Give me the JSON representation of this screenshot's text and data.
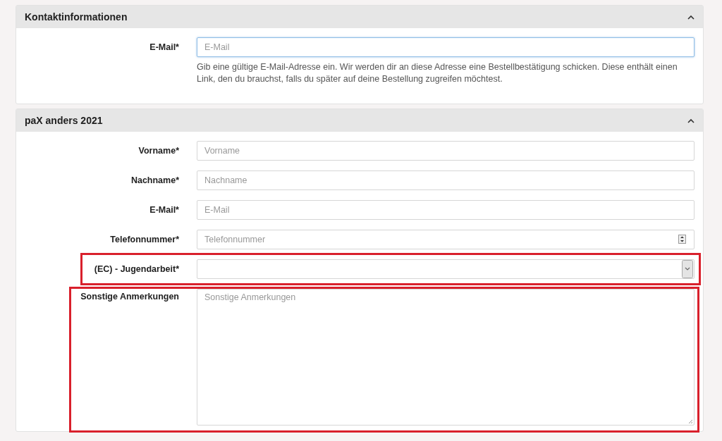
{
  "panels": [
    {
      "title": "Kontaktinformationen",
      "expanded": true,
      "fields": [
        {
          "kind": "email",
          "label": "E-Mail*",
          "placeholder": "E-Mail",
          "focused": true,
          "highlighted": false,
          "help": "Gib eine gültige E-Mail-Adresse ein. Wir werden dir an diese Adresse eine Bestellbestätigung schicken. Diese enthält einen Link, den du brauchst, falls du später auf deine Bestellung zugreifen möchtest."
        }
      ]
    },
    {
      "title": "paX anders 2021",
      "expanded": true,
      "fields": [
        {
          "kind": "text",
          "label": "Vorname*",
          "placeholder": "Vorname",
          "focused": false,
          "highlighted": false
        },
        {
          "kind": "text",
          "label": "Nachname*",
          "placeholder": "Nachname",
          "focused": false,
          "highlighted": false
        },
        {
          "kind": "email",
          "label": "E-Mail*",
          "placeholder": "E-Mail",
          "focused": false,
          "highlighted": false
        },
        {
          "kind": "number",
          "label": "Telefonnummer*",
          "placeholder": "Telefonnummer",
          "focused": false,
          "highlighted": false
        },
        {
          "kind": "select",
          "label": "(EC) - Jugendarbeit*",
          "focused": false,
          "highlighted": true
        },
        {
          "kind": "textarea",
          "label": "Sonstige Anmerkungen",
          "placeholder": "Sonstige Anmerkungen",
          "focused": false,
          "highlighted": true
        }
      ]
    }
  ]
}
